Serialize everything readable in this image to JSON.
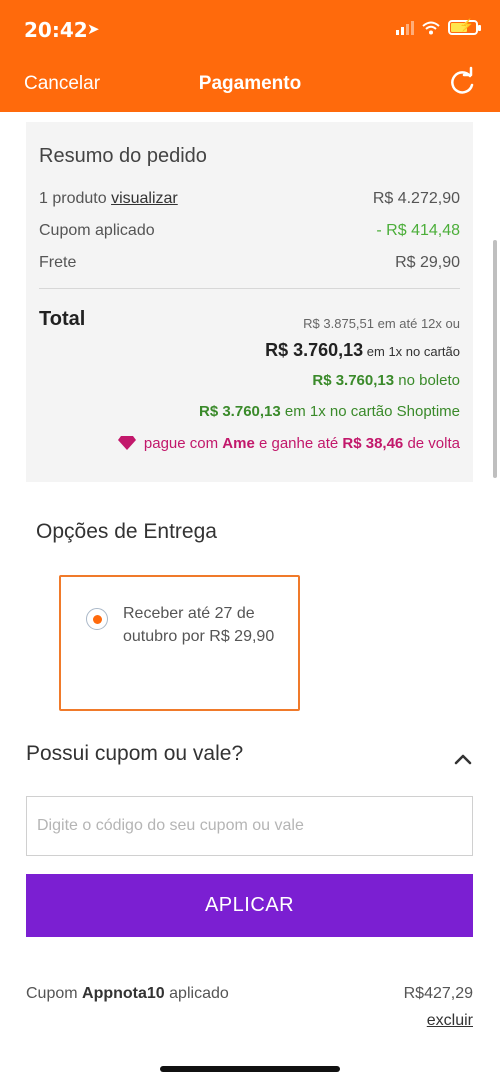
{
  "status_bar": {
    "time": "20:42",
    "location_icon": "location-arrow-icon",
    "signal_icon": "signal-bars-icon",
    "wifi_icon": "wifi-icon",
    "battery_icon": "battery-charging-icon",
    "battery_color": "#ffe54d"
  },
  "nav": {
    "cancel_label": "Cancelar",
    "title": "Pagamento",
    "refresh_icon": "refresh-icon"
  },
  "colors": {
    "brand_orange": "#ff6a0c",
    "apply_purple": "#7b1fd2",
    "discount_green": "#4cae3a",
    "ame_pink": "#c2186b"
  },
  "summary": {
    "title": "Resumo do pedido",
    "products_label": "1 produto",
    "view_link": "visualizar",
    "products_value": "R$ 4.272,90",
    "coupon_label": "Cupom aplicado",
    "coupon_value": "- R$ 414,48",
    "shipping_label": "Frete",
    "shipping_value": "R$ 29,90",
    "total_label": "Total",
    "installments": "R$ 3.875,51 em até 12x ou",
    "card_amount": "R$ 3.760,13",
    "card_suffix": "em 1x no cartão",
    "boleto_amount": "R$ 3.760,13",
    "boleto_suffix": "no boleto",
    "shoptime_amount": "R$ 3.760,13",
    "shoptime_suffix": "em 1x no cartão Shoptime",
    "ame_prefix": "pague com",
    "ame_brand": "Ame",
    "ame_middle": "e ganhe até",
    "ame_amount": "R$ 38,46",
    "ame_suffix": "de volta",
    "ame_icon": "ame-gem-icon"
  },
  "delivery": {
    "title": "Opções de Entrega",
    "option_text": "Receber até 27 de outubro por R$ 29,90",
    "option_selected": true
  },
  "coupon": {
    "title": "Possui cupom ou vale?",
    "toggle_icon": "chevron-up-icon",
    "placeholder": "Digite o código do seu cupom ou vale",
    "value": "",
    "apply_label": "APLICAR",
    "applied_prefix": "Cupom",
    "applied_code": "Appnota10",
    "applied_suffix": "aplicado",
    "applied_value": "R$427,29",
    "remove_label": "excluir"
  }
}
